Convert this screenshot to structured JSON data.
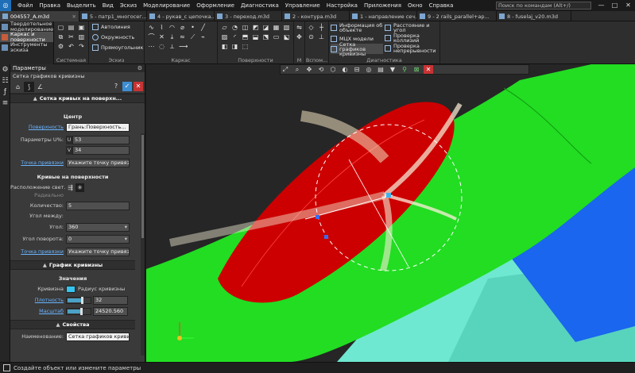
{
  "app": {
    "logo_glyph": "◎",
    "menu": [
      "Файл",
      "Правка",
      "Выделить",
      "Вид",
      "Эскиз",
      "Моделирование",
      "Оформление",
      "Диагностика",
      "Управление",
      "Настройка",
      "Приложения",
      "Окно",
      "Справка"
    ],
    "search_placeholder": "Поиск по командам (Alt+/)",
    "window_buttons": [
      "—",
      "□",
      "✕"
    ]
  },
  "tabs": [
    {
      "label": "004557_A.m3d",
      "active": true
    },
    {
      "label": "5 - патр1_многосег...",
      "active": false
    },
    {
      "label": "4 - рукав_с цепочка...",
      "active": false
    },
    {
      "label": "3 - переход.m3d",
      "active": false
    },
    {
      "label": "2 - контура.m3d",
      "active": false
    },
    {
      "label": "1 - направление сеч...",
      "active": false
    },
    {
      "label": "9 - 2 rails_parallel+ap...",
      "active": false
    },
    {
      "label": "8 - fuselaj_v20.m3d",
      "active": false
    }
  ],
  "ribbon": {
    "modes": [
      {
        "label": "Твердотельное моделирование",
        "active": false
      },
      {
        "label": "Каркас и поверхности",
        "active": true
      },
      {
        "label": "Инструменты эскиза",
        "active": false
      }
    ],
    "groups": {
      "system": "Системная",
      "sketch": "Эскиз",
      "frame": "Каркас",
      "surfaces": "Поверхности",
      "m": "М",
      "aux": "Вспом...",
      "diagnostics": "Диагностика"
    },
    "sketch_tools": [
      "Автолиния",
      "Окружность",
      "Прямоугольник"
    ],
    "diag_tools": [
      {
        "label": "Информация об объекте",
        "active": false
      },
      {
        "label": "МЦХ модели",
        "active": false
      },
      {
        "label": "Сетка графиков кривизны",
        "active": true
      },
      {
        "label": "Расстояние и угол",
        "active": false
      },
      {
        "label": "Проверка коллизий",
        "active": false
      },
      {
        "label": "Проверка непрерывности",
        "active": false
      }
    ]
  },
  "panel": {
    "title": "Параметры",
    "command": "Сетка графиков кривизны",
    "sections": {
      "grid": "Сетка кривых на поверхн...",
      "graph": "График кривизны",
      "props": "Свойства"
    },
    "center_hdr": "Центр",
    "surface_label": "Поверхность",
    "surface_value": "Грань:Поверхность...",
    "uv_label": "Параметры U%:",
    "u_key": "U",
    "u_value": "53",
    "v_key": "V",
    "v_value": "34",
    "anchor_label": "Точка привязки",
    "anchor_placeholder": "Укажите точку привязки",
    "curves_hdr": "Кривые на поверхности",
    "layout_label": "Расположение свет...",
    "radial_label": "Радиально",
    "count_label": "Количество:",
    "count_value": "5",
    "angle_between_label": "Угол между:",
    "angle_label": "Угол:",
    "angle_value": "360",
    "rotation_label": "Угол поворота:",
    "rotation_value": "0",
    "anchor2_label": "Точка привязки",
    "anchor2_placeholder": "Укажите точку привязки",
    "values_hdr": "Значения",
    "curvature_label": "Кривизна",
    "curvature_radius": "Радиус кривизны",
    "density_label": "Плотность",
    "density_value": "32",
    "density_fraction": 0.6,
    "scale_label": "Масштаб",
    "scale_value": "24520.560",
    "scale_fraction": 0.55,
    "name_label": "Наименование:",
    "name_value": "Сетка графиков кривизны"
  },
  "status": "Создайте объект или измените параметры",
  "colors": {
    "accent_blue": "#3c8dd1",
    "cancel_red": "#c73333",
    "surface_red": "#cc0000",
    "surface_green": "#22dd22",
    "surface_cyan": "#6ee8d0",
    "surface_blue": "#1a66ee",
    "curvature_swatch": "#35c4f0"
  }
}
